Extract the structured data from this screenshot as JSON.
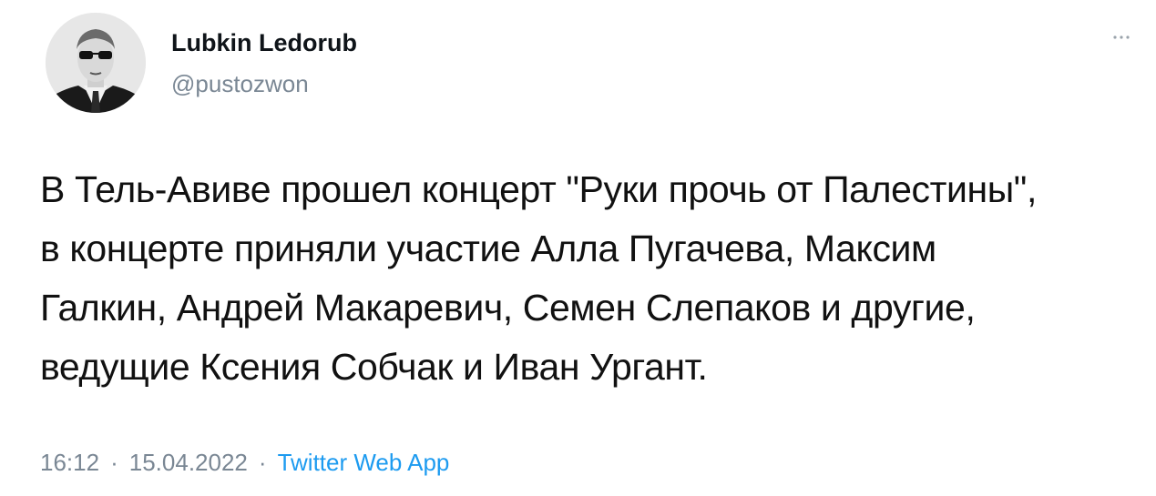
{
  "tweet": {
    "author": {
      "display_name": "Lubkin Ledorub",
      "username": "@pustozwon",
      "avatar_icon": "profile-photo-man-with-dark-glasses"
    },
    "more_icon": "more-horizontal-icon",
    "text_lines": [
      "В Тель-Авиве прошел концерт \"Руки прочь от Палестины\",",
      "в концерте приняли участие Алла Пугачева, Максим",
      "Галкин, Андрей Макаревич, Семен Слепаков и другие,",
      "ведущие Ксения Собчак и Иван Ургант."
    ],
    "meta": {
      "time": "16:12",
      "separator": "·",
      "date": "15.04.2022",
      "source": "Twitter Web App"
    },
    "colors": {
      "text": "#0f1419",
      "secondary": "#7a8794",
      "link": "#1d9bf0",
      "background": "#ffffff"
    }
  }
}
